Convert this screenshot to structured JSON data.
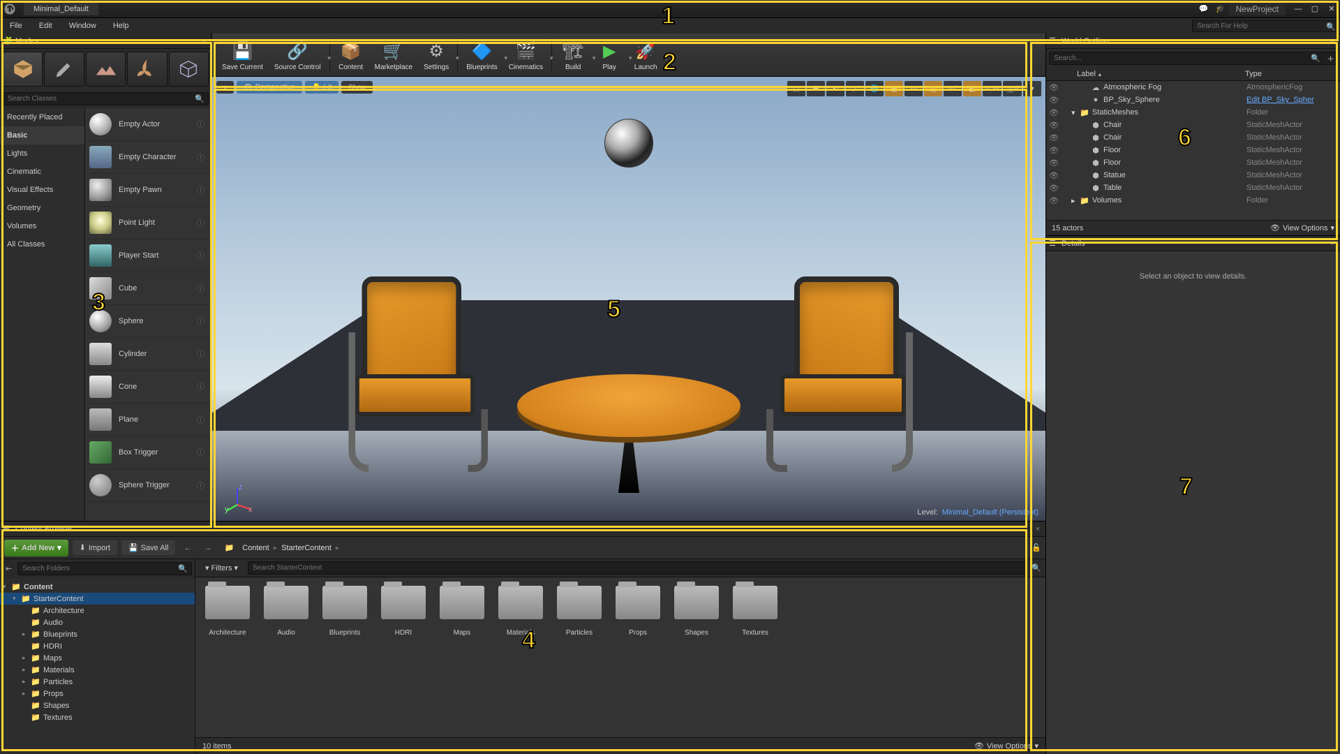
{
  "title_tab": "Minimal_Default",
  "project_name": "NewProject",
  "help_search_ph": "Search For Help",
  "menu": [
    "File",
    "Edit",
    "Window",
    "Help"
  ],
  "modes_panel": {
    "title": "Modes",
    "search_ph": "Search Classes",
    "categories": [
      "Recently Placed",
      "Basic",
      "Lights",
      "Cinematic",
      "Visual Effects",
      "Geometry",
      "Volumes",
      "All Classes"
    ],
    "selected_category": "Basic",
    "actors": [
      "Empty Actor",
      "Empty Character",
      "Empty Pawn",
      "Point Light",
      "Player Start",
      "Cube",
      "Sphere",
      "Cylinder",
      "Cone",
      "Plane",
      "Box Trigger",
      "Sphere Trigger"
    ]
  },
  "toolbar": [
    {
      "label": "Save Current",
      "dd": false
    },
    {
      "label": "Source Control",
      "dd": true
    },
    {
      "label": "Content",
      "dd": false,
      "sep": true
    },
    {
      "label": "Marketplace",
      "dd": false
    },
    {
      "label": "Settings",
      "dd": true
    },
    {
      "label": "Blueprints",
      "dd": true,
      "sep": true
    },
    {
      "label": "Cinematics",
      "dd": true
    },
    {
      "label": "Build",
      "dd": true,
      "sep": true
    },
    {
      "label": "Play",
      "dd": true
    },
    {
      "label": "Launch",
      "dd": true
    }
  ],
  "viewport": {
    "perspective": "Perspective",
    "lit": "Lit",
    "show": "Show",
    "grid_snap": "10",
    "angle_snap": "10°",
    "scale_snap": "0.25",
    "cam_speed": "4",
    "level_label": "Level:",
    "level_name": "Minimal_Default (Persistent)"
  },
  "outliner": {
    "title": "World Outliner",
    "search_ph": "Search...",
    "col_label": "Label",
    "col_type": "Type",
    "rows": [
      {
        "indent": 1,
        "icon": "cloud",
        "label": "Atmospheric Fog",
        "type": "AtmosphericFog"
      },
      {
        "indent": 1,
        "icon": "sphere",
        "label": "BP_Sky_Sphere",
        "type": "Edit BP_Sky_Spher",
        "link": true
      },
      {
        "indent": 0,
        "icon": "folder",
        "arrow": "▾",
        "label": "StaticMeshes",
        "type": "Folder"
      },
      {
        "indent": 1,
        "icon": "mesh",
        "label": "Chair",
        "type": "StaticMeshActor"
      },
      {
        "indent": 1,
        "icon": "mesh",
        "label": "Chair",
        "type": "StaticMeshActor"
      },
      {
        "indent": 1,
        "icon": "mesh",
        "label": "Floor",
        "type": "StaticMeshActor"
      },
      {
        "indent": 1,
        "icon": "mesh",
        "label": "Floor",
        "type": "StaticMeshActor"
      },
      {
        "indent": 1,
        "icon": "mesh",
        "label": "Statue",
        "type": "StaticMeshActor"
      },
      {
        "indent": 1,
        "icon": "mesh",
        "label": "Table",
        "type": "StaticMeshActor"
      },
      {
        "indent": 0,
        "icon": "folder",
        "arrow": "▸",
        "label": "Volumes",
        "type": "Folder"
      }
    ],
    "footer_count": "15 actors",
    "view_options": "View Options"
  },
  "details": {
    "title": "Details",
    "empty": "Select an object to view details."
  },
  "content_browser": {
    "title": "Content Browser",
    "add_new": "Add New",
    "import": "Import",
    "save_all": "Save All",
    "breadcrumb": [
      "Content",
      "StarterContent"
    ],
    "search_folders_ph": "Search Folders",
    "filters": "Filters",
    "search_content_ph": "Search StarterContent",
    "tree_root": "Content",
    "tree": [
      {
        "label": "StarterContent",
        "indent": 1,
        "sel": true,
        "open": true
      },
      {
        "label": "Architecture",
        "indent": 2
      },
      {
        "label": "Audio",
        "indent": 2
      },
      {
        "label": "Blueprints",
        "indent": 2,
        "arrow": "▸"
      },
      {
        "label": "HDRI",
        "indent": 2
      },
      {
        "label": "Maps",
        "indent": 2,
        "arrow": "▸"
      },
      {
        "label": "Materials",
        "indent": 2,
        "arrow": "▸"
      },
      {
        "label": "Particles",
        "indent": 2,
        "arrow": "▸"
      },
      {
        "label": "Props",
        "indent": 2,
        "arrow": "▸"
      },
      {
        "label": "Shapes",
        "indent": 2
      },
      {
        "label": "Textures",
        "indent": 2
      }
    ],
    "folders": [
      "Architecture",
      "Audio",
      "Blueprints",
      "HDRI",
      "Maps",
      "Materials",
      "Particles",
      "Props",
      "Shapes",
      "Textures"
    ],
    "item_count": "10 items",
    "view_options": "View Options"
  },
  "annotations": {
    "1": "1",
    "2": "2",
    "3": "3",
    "4": "4",
    "5": "5",
    "6": "6",
    "7": "7"
  }
}
